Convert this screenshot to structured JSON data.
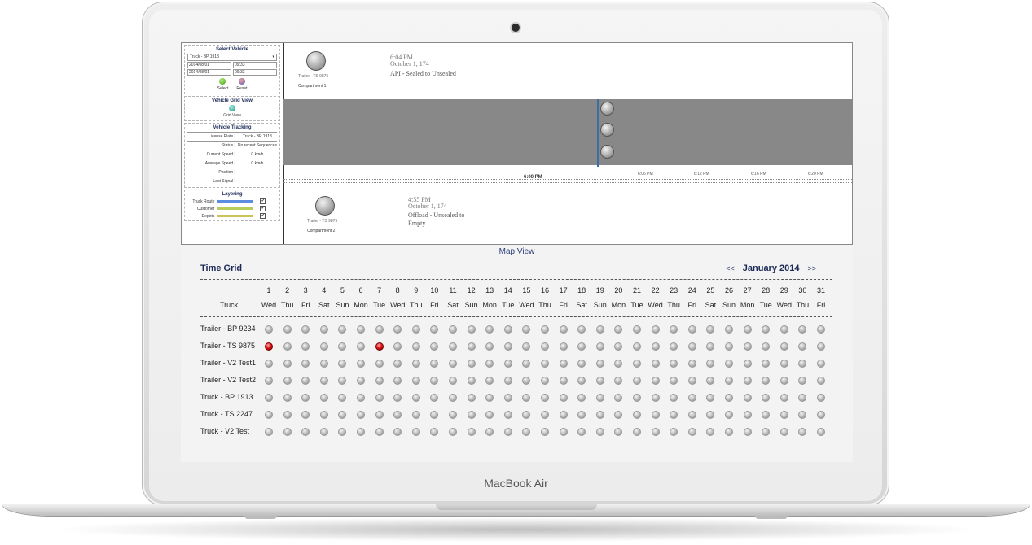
{
  "device": {
    "brand": "MacBook Air"
  },
  "sidebar": {
    "select_vehicle": {
      "title": "Select Vehicle",
      "vehicle": "Truck - BP 1913",
      "start_date": "2014/08/01",
      "start_time": "09:33",
      "end_date": "2014/08/01",
      "end_time": "09:33",
      "select_label": "Select",
      "reset_label": "Reset"
    },
    "grid_view": {
      "title": "Vehicle Grid View",
      "button_label": "Grid View"
    },
    "tracking": {
      "title": "Vehicle Tracking",
      "rows": [
        {
          "k": "License Plate |",
          "v": "Truck - BP 1913"
        },
        {
          "k": "Status |",
          "v": "No recent Sequences"
        },
        {
          "k": "Current Speed |",
          "v": "0 km/h"
        },
        {
          "k": "Average Speed |",
          "v": "0 km/h"
        },
        {
          "k": "Position |",
          "v": ""
        },
        {
          "k": "Last Signal |",
          "v": ""
        }
      ]
    },
    "layering": {
      "title": "Layering",
      "rows": [
        {
          "k": "Truck Route",
          "color": "#5b8ee0"
        },
        {
          "k": "Customer",
          "color": "#b7cf5a"
        },
        {
          "k": "Depots",
          "color": "#c9c35a"
        }
      ]
    }
  },
  "timeline": {
    "event1": {
      "trailer": "Trailer - TS 9875",
      "compartment": "Compartment 1",
      "time": "6:04 PM",
      "date": "October 1, 174",
      "label": "API - Sealed to Unsealed"
    },
    "event2": {
      "trailer": "Trailer - TS 9875",
      "compartment": "Compartment 2",
      "time": "4:55 PM",
      "date": "October 1, 174",
      "label1": "Offload - Unsealed to",
      "label2": "Empty"
    },
    "ticks_major": "6:00 PM",
    "ticks_minor": [
      "6:06 PM",
      "6:12 PM",
      "6:16 PM",
      "6:20 PM"
    ]
  },
  "map_view_label": "Map View",
  "time_grid": {
    "title": "Time Grid",
    "prev": "<<",
    "next": ">>",
    "month": "January 2014",
    "truck_header": "Truck",
    "days": [
      "Wed",
      "Thu",
      "Fri",
      "Sat",
      "Sun",
      "Mon",
      "Tue",
      "Wed",
      "Thu",
      "Fri",
      "Sat",
      "Sun",
      "Mon",
      "Tue",
      "Wed",
      "Thu",
      "Fri",
      "Sat",
      "Sun",
      "Mon",
      "Tue",
      "Wed",
      "Thu",
      "Fri",
      "Sat",
      "Sun",
      "Mon",
      "Tue",
      "Wed",
      "Thu",
      "Fri"
    ],
    "rows": [
      {
        "label": "Trailer - BP 9234",
        "red_days": []
      },
      {
        "label": "Trailer - TS 9875",
        "red_days": [
          1,
          7
        ]
      },
      {
        "label": "Trailer - V2 Test1",
        "red_days": []
      },
      {
        "label": "Trailer - V2 Test2",
        "red_days": []
      },
      {
        "label": "Truck - BP 1913",
        "red_days": []
      },
      {
        "label": "Truck - TS 2247",
        "red_days": []
      },
      {
        "label": "Truck - V2 Test",
        "red_days": []
      }
    ]
  }
}
